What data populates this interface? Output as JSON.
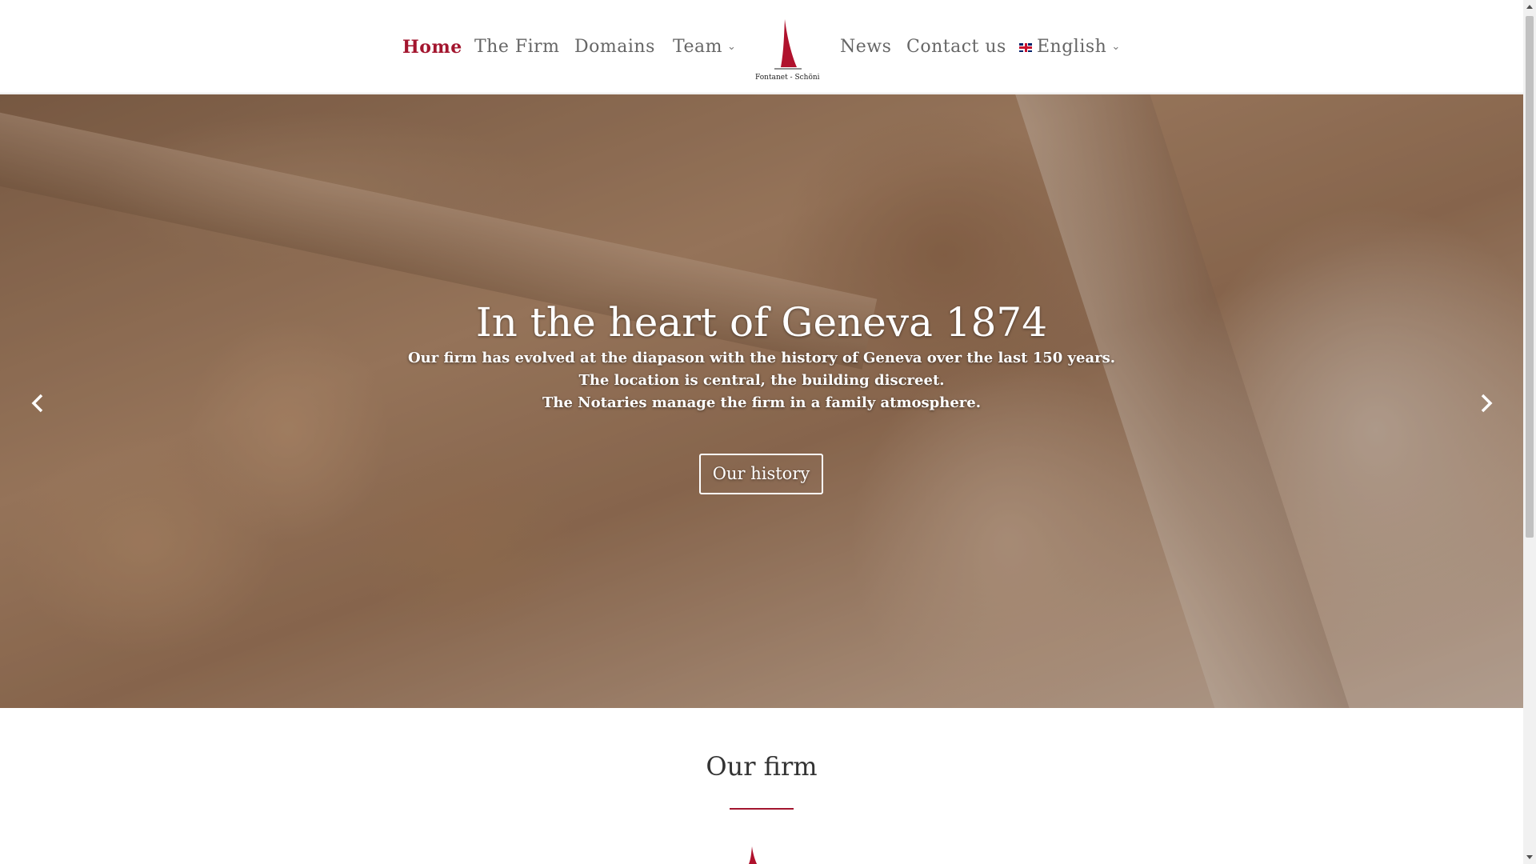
{
  "nav": {
    "left_items": [
      {
        "label": "Home",
        "active": true
      },
      {
        "label": "The Firm"
      },
      {
        "label": "Domains"
      },
      {
        "label": "Team",
        "has_dropdown": true
      }
    ],
    "right_items": [
      {
        "label": "News"
      },
      {
        "label": "Contact us"
      },
      {
        "label": "English",
        "has_dropdown": true,
        "flag_icon": "uk-flag-icon"
      }
    ],
    "logo_text": "Fontanet - Schöni"
  },
  "hero": {
    "title": "In the heart of Geneva 1874",
    "lines": [
      "Our firm has evolved at the diapason with the history of Geneva over the last 150 years.",
      "The location is central, the building discreet.",
      "The Notaries manage the firm in a family atmosphere."
    ],
    "button_label": "Our history",
    "prev_icon": "chevron-left-icon",
    "next_icon": "chevron-right-icon"
  },
  "section": {
    "title": "Our firm"
  },
  "colors": {
    "accent": "#a3152e",
    "nav_text": "#666666",
    "heading_text": "#333333"
  }
}
